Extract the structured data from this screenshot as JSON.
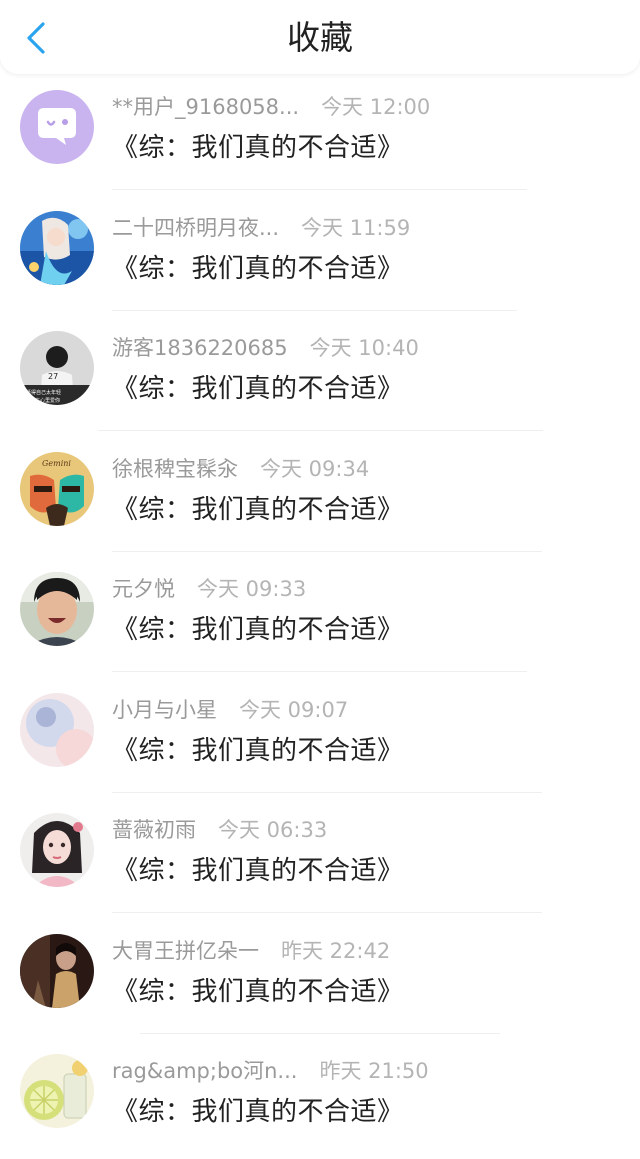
{
  "header": {
    "title": "收藏",
    "back_icon": "chevron-left-icon",
    "accent": "#2ba4ee"
  },
  "items": [
    {
      "name": "**用户_9168058...",
      "time": "今天 12:00",
      "message": "《综：我们真的不合适》"
    },
    {
      "name": "二十四桥明月夜...",
      "time": "今天 11:59",
      "message": "《综：我们真的不合适》"
    },
    {
      "name": "游客1836220685",
      "time": "今天 10:40",
      "message": "《综：我们真的不合适》",
      "avatar_caption": [
        "27",
        "活得自己太年轻",
        "我在心里爱你"
      ]
    },
    {
      "name": "徐根稗宝髹汆",
      "time": "今天 09:34",
      "message": "《综：我们真的不合适》",
      "avatar_caption": [
        "Gemini"
      ]
    },
    {
      "name": "元夕悦",
      "time": "今天 09:33",
      "message": "《综：我们真的不合适》"
    },
    {
      "name": "小月与小星",
      "time": "今天 09:07",
      "message": "《综：我们真的不合适》"
    },
    {
      "name": "蔷薇初雨",
      "time": "今天 06:33",
      "message": "《综：我们真的不合适》"
    },
    {
      "name": "大胃王拼亿朵一",
      "time": "昨天 22:42",
      "message": "《综：我们真的不合适》"
    },
    {
      "name": "rag&amp;bo河n...",
      "time": "昨天 21:50",
      "message": "《综：我们真的不合适》"
    }
  ]
}
